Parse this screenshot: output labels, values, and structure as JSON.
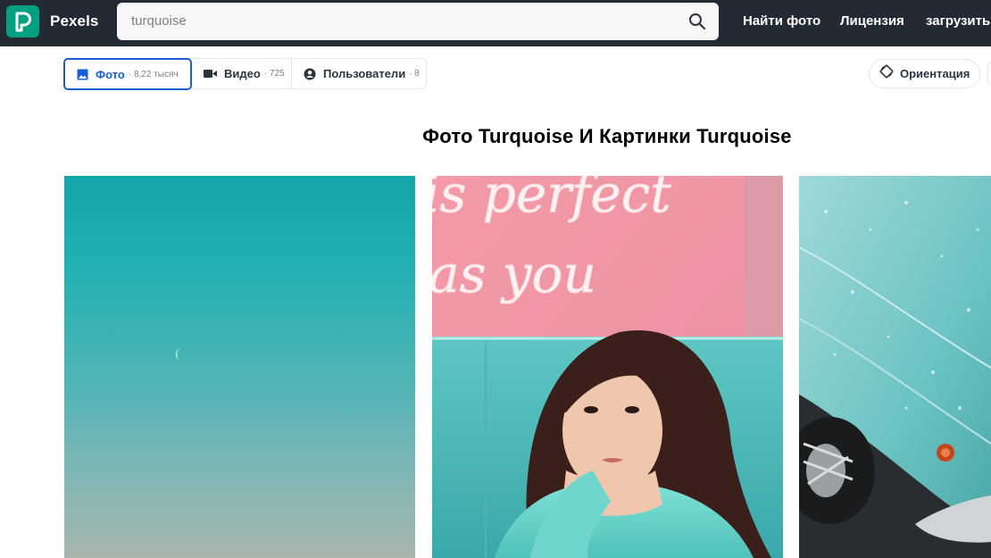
{
  "header": {
    "brand": "Pexels",
    "search": {
      "value": "turquoise",
      "icon": "search-icon"
    },
    "nav": [
      {
        "label": "Найти фото"
      },
      {
        "label": "Лицензия"
      },
      {
        "label": "загрузить"
      }
    ]
  },
  "tabs": [
    {
      "label": "Фото",
      "count": "· 8,22 тысяч",
      "icon": "image-icon",
      "active": true
    },
    {
      "label": "Видео",
      "count": "· 725",
      "icon": "video-camera-icon",
      "active": false
    },
    {
      "label": "Пользователи",
      "count": "· 8",
      "icon": "user-icon",
      "active": false
    }
  ],
  "filters": {
    "orientation_label": "Ориентация",
    "icon": "orientation-icon"
  },
  "main": {
    "title": "Фото Turquoise И Картинки Turquoise",
    "photos": [
      {
        "subject": "turquoise sky with moon"
      },
      {
        "subject": "woman in turquoise sweater under pink neon sign"
      },
      {
        "subject": "turquoise vintage car with rain drops"
      }
    ],
    "neon_text": [
      "is perfect",
      "as you"
    ]
  },
  "colors": {
    "topbar": "#232a34",
    "brand_green": "#05a081",
    "accent_blue": "#1a5fd8"
  }
}
